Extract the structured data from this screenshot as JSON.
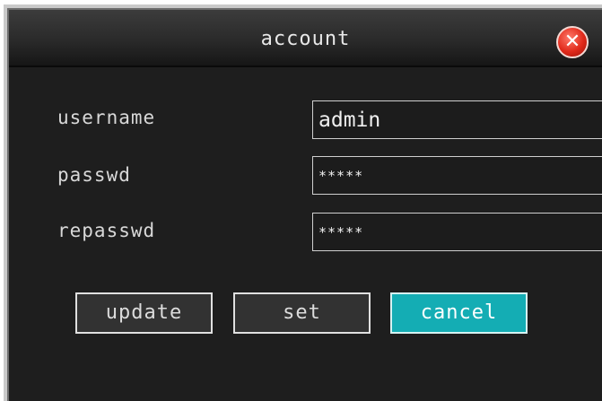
{
  "window": {
    "title": "account"
  },
  "form": {
    "username_label": "username",
    "username_value": "admin",
    "passwd_label": "passwd",
    "passwd_value": "*****",
    "repasswd_label": "repasswd",
    "repasswd_value": "*****"
  },
  "buttons": {
    "update": "update",
    "set": "set",
    "cancel": "cancel"
  },
  "icons": {
    "close": "close-icon"
  },
  "colors": {
    "background": "#1e1e1e",
    "accent": "#14adb4",
    "close": "#e0291a"
  }
}
